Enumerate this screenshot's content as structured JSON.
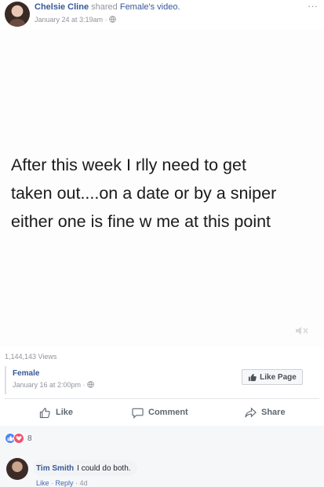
{
  "post": {
    "poster_name": "Chelsie Cline",
    "shared_text": "shared",
    "shared_target": "Female's video.",
    "timestamp": "January 24 at 3:19am",
    "more_glyph": "···",
    "privacy_icon": "globe-icon"
  },
  "video": {
    "text_lines": [
      "After this week I rlly need to get",
      "taken out....on a date or by a sniper",
      "either one is fine w me at this point"
    ],
    "volume_icon": "volume-icon"
  },
  "views": "1,144,143 Views",
  "source_page": {
    "name": "Female",
    "timestamp": "January 16 at 2:00pm",
    "meta_separator": "·",
    "like_page_label": "Like Page"
  },
  "actions": {
    "like_label": "Like",
    "comment_label": "Comment",
    "share_label": "Share"
  },
  "reactions": {
    "count": "8",
    "types": [
      "like",
      "love"
    ],
    "colors": {
      "like": "#4e84f7",
      "love": "#f0536c"
    }
  },
  "comment": {
    "author": "Tim Smith",
    "text": "I could do both.",
    "like_label": "Like",
    "reply_label": "Reply",
    "separator": " · ",
    "age": "4d"
  },
  "colors": {
    "link_blue": "#365899",
    "meta_gray": "#90949c",
    "background": "#ffffff"
  }
}
